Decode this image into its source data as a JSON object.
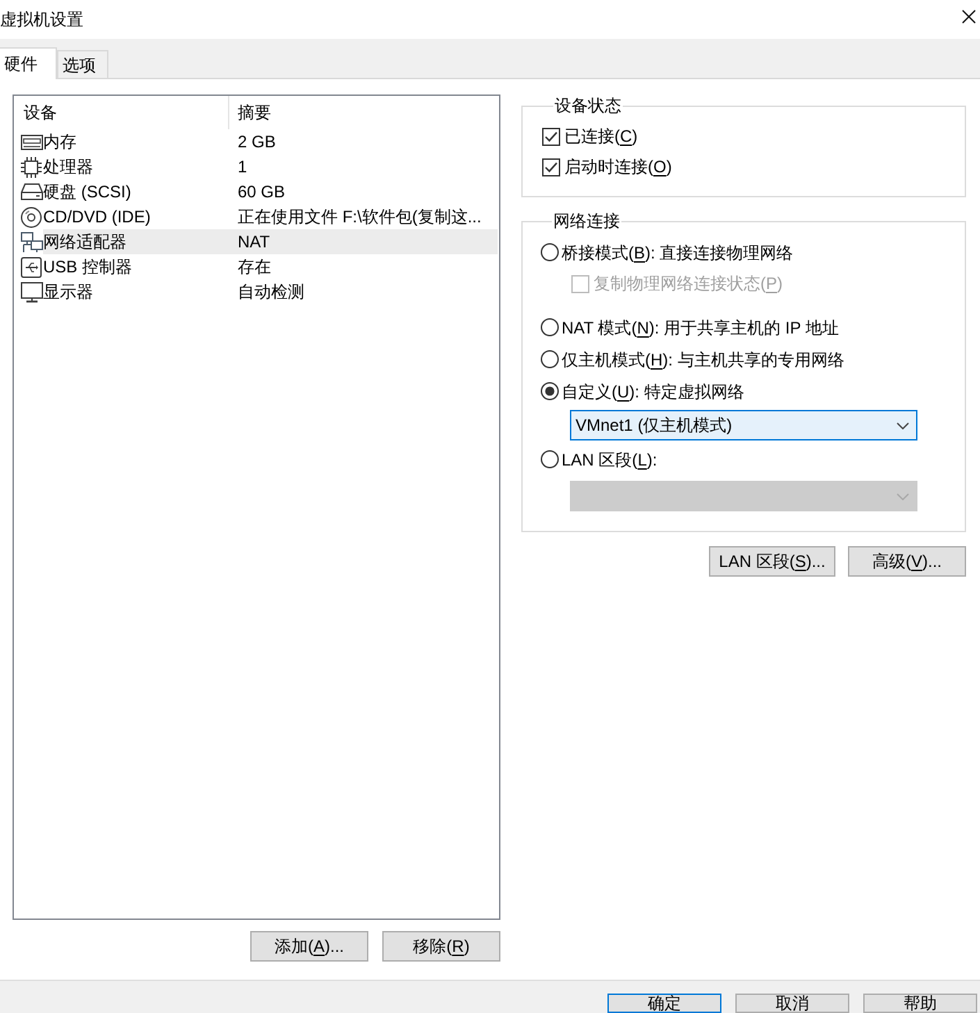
{
  "window": {
    "title": "虚拟机设置"
  },
  "tabs": [
    {
      "label": "硬件",
      "selected": true
    },
    {
      "label": "选项",
      "selected": false
    }
  ],
  "device_list": {
    "columns": [
      "设备",
      "摘要"
    ],
    "rows": [
      {
        "kind": "memory",
        "device": "内存",
        "summary": "2 GB",
        "selected": false
      },
      {
        "kind": "cpu",
        "device": "处理器",
        "summary": "1",
        "selected": false
      },
      {
        "kind": "disk",
        "device": "硬盘 (SCSI)",
        "summary": "60 GB",
        "selected": false
      },
      {
        "kind": "cdrom",
        "device": "CD/DVD (IDE)",
        "summary": "正在使用文件 F:\\软件包(复制这...",
        "selected": false
      },
      {
        "kind": "network",
        "device": "网络适配器",
        "summary": "NAT",
        "selected": true
      },
      {
        "kind": "usb",
        "device": "USB 控制器",
        "summary": "存在",
        "selected": false
      },
      {
        "kind": "display",
        "device": "显示器",
        "summary": "自动检测",
        "selected": false
      }
    ]
  },
  "device_buttons": [
    {
      "before": "添加(",
      "access_key": "A",
      "after": ")..."
    },
    {
      "before": "移除(",
      "access_key": "R",
      "after": ")"
    }
  ],
  "device_status": {
    "title": "设备状态",
    "options": [
      {
        "label": {
          "before": "已连接(",
          "access_key": "C",
          "after": ")"
        },
        "checked": true
      },
      {
        "label": {
          "before": "启动时连接(",
          "access_key": "O",
          "after": ")"
        },
        "checked": true
      }
    ]
  },
  "network_connection": {
    "title": "网络连接",
    "items": [
      {
        "kind": "radio",
        "label": {
          "before": "桥接模式(",
          "access_key": "B",
          "after": "): 直接连接物理网络"
        },
        "selected": false
      },
      {
        "kind": "checkbox",
        "label": {
          "before": "复制物理网络连接状态(",
          "access_key": "P",
          "after": ")"
        },
        "checked": false,
        "disabled": true
      },
      {
        "kind": "radio",
        "label": {
          "before": "NAT 模式(",
          "access_key": "N",
          "after": "): 用于共享主机的 IP 地址"
        },
        "selected": false
      },
      {
        "kind": "radio",
        "label": {
          "before": "仅主机模式(",
          "access_key": "H",
          "after": "): 与主机共享的专用网络"
        },
        "selected": false
      },
      {
        "kind": "radio",
        "label": {
          "before": "自定义(",
          "access_key": "U",
          "after": "): 特定虚拟网络"
        },
        "selected": true
      },
      {
        "kind": "dropdown",
        "value": "VMnet1 (仅主机模式)",
        "disabled": false
      },
      {
        "kind": "radio",
        "label": {
          "before": "LAN 区段(",
          "access_key": "L",
          "after": "):"
        },
        "selected": false
      },
      {
        "kind": "dropdown",
        "disabled": true
      }
    ]
  },
  "network_buttons": [
    {
      "before": "LAN 区段(",
      "access_key": "S",
      "after": ")..."
    },
    {
      "before": "高级(",
      "access_key": "V",
      "after": ")..."
    }
  ],
  "dialog_buttons": [
    {
      "label": "确定",
      "default": true
    },
    {
      "label": "取消",
      "default": false
    },
    {
      "label": "帮助",
      "default": false
    }
  ]
}
